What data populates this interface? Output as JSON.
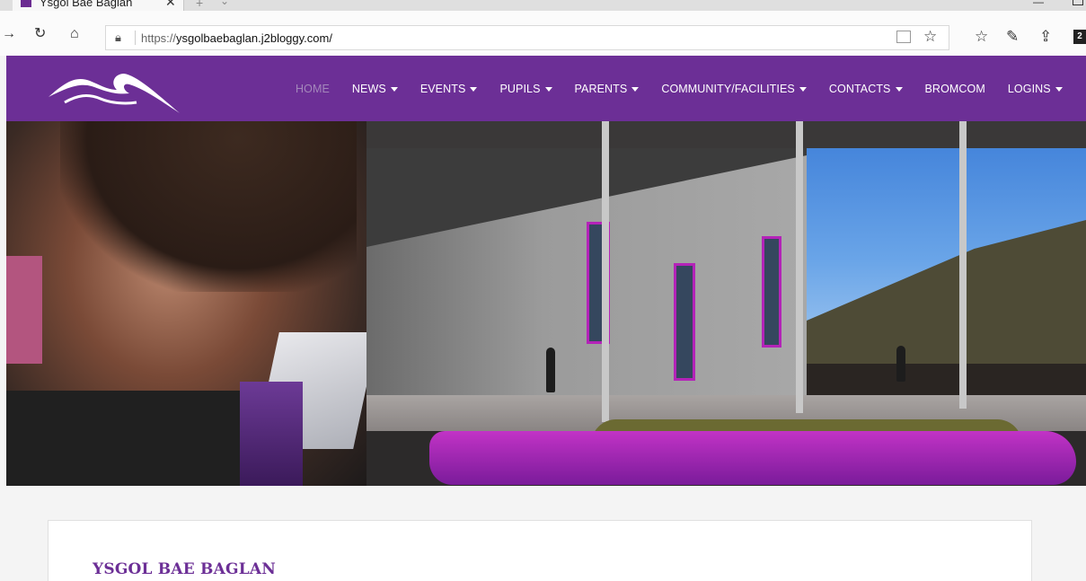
{
  "browser": {
    "tab_title": "Ysgol Bae Baglan",
    "url_scheme": "https://",
    "url_host": "ysgolbaebaglan.j2bloggy.com/",
    "ext_badge": "2"
  },
  "site": {
    "brand_color": "#6c2f96",
    "nav": [
      {
        "label": "HOME",
        "dropdown": false,
        "active": true
      },
      {
        "label": "NEWS",
        "dropdown": true
      },
      {
        "label": "EVENTS",
        "dropdown": true
      },
      {
        "label": "PUPILS",
        "dropdown": true
      },
      {
        "label": "PARENTS",
        "dropdown": true
      },
      {
        "label": "COMMUNITY/FACILITIES",
        "dropdown": true
      },
      {
        "label": "CONTACTS",
        "dropdown": true
      },
      {
        "label": "BROMCOM",
        "dropdown": false
      },
      {
        "label": "LOGINS",
        "dropdown": true
      }
    ],
    "content_title": "YSGOL BAE BAGLAN"
  }
}
